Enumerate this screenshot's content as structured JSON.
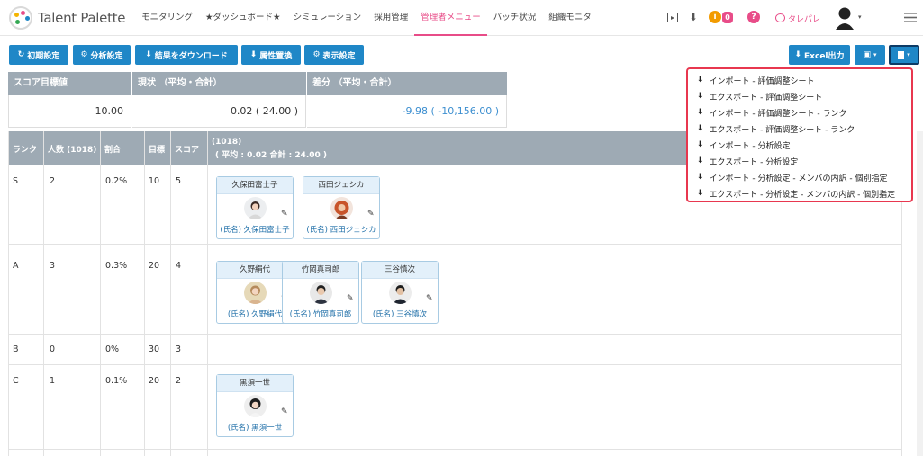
{
  "app": {
    "logo_text": "Talent Palette"
  },
  "nav": {
    "items": [
      "モニタリング",
      "★ダッシュボード★",
      "シミュレーション",
      "採用管理",
      "管理者メニュー",
      "バッチ状況",
      "組織モニタ"
    ],
    "active_index": 4
  },
  "header_right": {
    "tarepare_label": "タレパレ",
    "notification_count": "0"
  },
  "toolbar": {
    "initial_settings": "初期設定",
    "analysis_settings": "分析設定",
    "download_results": "結果をダウンロード",
    "attribute_replace": "属性置換",
    "display_settings": "表示設定",
    "excel_export": "Excel出力"
  },
  "summary": {
    "target_label": "スコア目標値",
    "current_label": "現状 （平均・合計）",
    "diff_label": "差分 （平均・合計）",
    "target_value": "10.00",
    "current_value": "0.02 ( 24.00 )",
    "diff_value": "-9.98 ( -10,156.00 )"
  },
  "table": {
    "headers": {
      "rank": "ランク",
      "count": "人数 (1018)",
      "ratio": "割合",
      "target": "目標",
      "score": "スコア",
      "members_line1": "(1018)",
      "members_line2": "( 平均 : 0.02 合計 : 24.00 )"
    },
    "rows": [
      {
        "rank": "S",
        "count": "2",
        "ratio": "0.2%",
        "target": "10",
        "score": "5",
        "cards": [
          {
            "name": "久保田富士子",
            "footer": "(氏名) 久保田富士子"
          },
          {
            "name": "西田ジェシカ",
            "footer": "(氏名) 西田ジェシカ"
          }
        ]
      },
      {
        "rank": "A",
        "count": "3",
        "ratio": "0.3%",
        "target": "20",
        "score": "4",
        "cards": [
          {
            "name": "久野絹代",
            "footer": "(氏名) 久野絹代"
          },
          {
            "name": "竹岡真司郎",
            "footer": "(氏名) 竹岡真司郎"
          },
          {
            "name": "三谷慎次",
            "footer": "(氏名) 三谷慎次"
          }
        ]
      },
      {
        "rank": "B",
        "count": "0",
        "ratio": "0%",
        "target": "30",
        "score": "3",
        "cards": []
      },
      {
        "rank": "C",
        "count": "1",
        "ratio": "0.1%",
        "target": "20",
        "score": "2",
        "cards": [
          {
            "name": "黒須一世",
            "footer": "(氏名) 黒須一世"
          }
        ]
      }
    ]
  },
  "dropdown": {
    "items": [
      "インポート - 評価調整シート",
      "エクスポート - 評価調整シート",
      "インポート - 評価調整シート - ランク",
      "エクスポート - 評価調整シート - ランク",
      "インポート - 分析設定",
      "エクスポート - 分析設定",
      "インポート - 分析設定 - メンバの内訳 - 個別指定",
      "エクスポート - 分析設定 - メンバの内訳 - 個別指定"
    ]
  },
  "colors": {
    "accent": "#1f87c7",
    "active_nav": "#e84c88",
    "header_gray": "#9eaab4",
    "dropdown_border": "#e8374f",
    "diff_value": "#3d8fd0"
  }
}
